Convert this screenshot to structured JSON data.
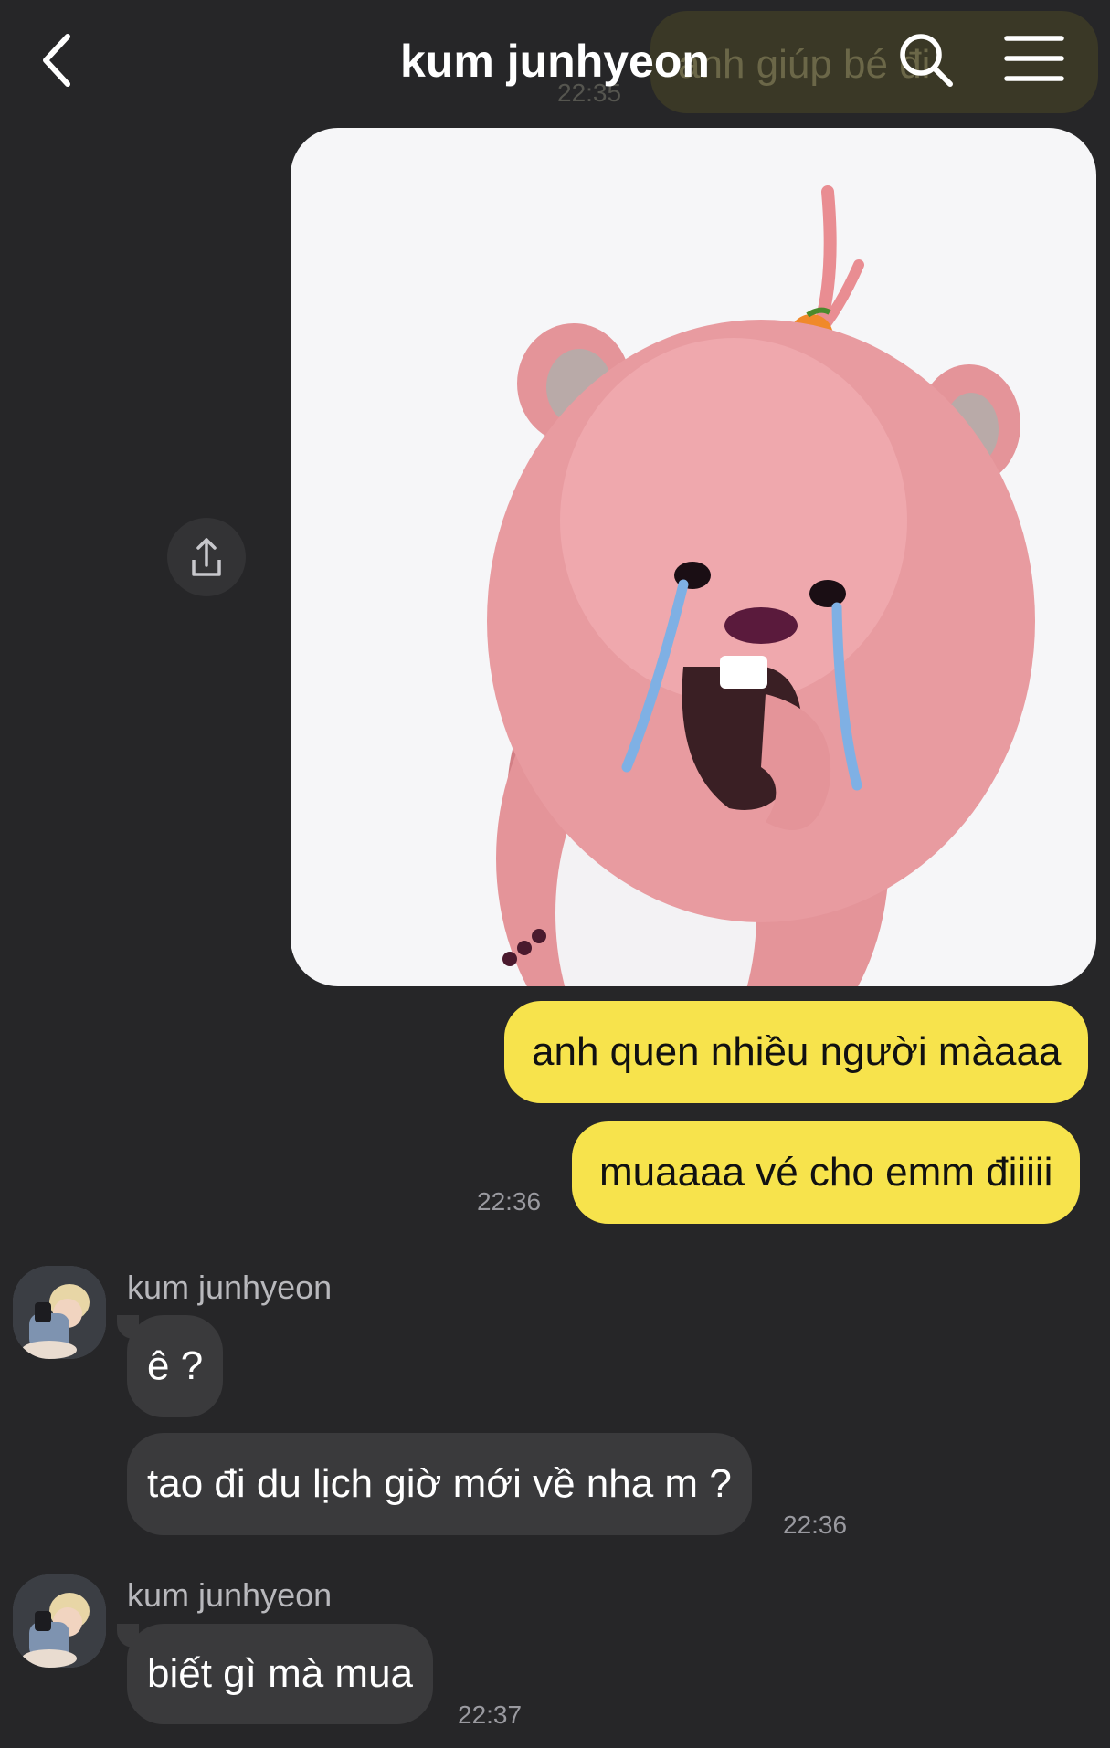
{
  "header": {
    "title": "kum junhyeon",
    "back_icon": "chevron-left-icon",
    "search_icon": "search-icon",
    "menu_icon": "menu-icon"
  },
  "ghost_message": {
    "text": "anh giúp bé đi",
    "time": "22:35"
  },
  "sticker": {
    "description_icon": "pink-beaver-crying-sticker",
    "share_icon": "share-icon"
  },
  "outgoing": [
    {
      "text": "anh quen nhiều người màaaa"
    },
    {
      "text": "muaaaa vé cho emm điiiii",
      "time": "22:36"
    }
  ],
  "incoming_groups": [
    {
      "sender": "kum junhyeon",
      "messages": [
        {
          "text": "ê ?"
        },
        {
          "text": "tao đi du lịch giờ mới về nha m ?",
          "time": "22:36"
        }
      ]
    },
    {
      "sender": "kum junhyeon",
      "messages": [
        {
          "text": "biết gì mà mua",
          "time": "22:37"
        }
      ]
    }
  ],
  "colors": {
    "background": "#262628",
    "outgoing_bubble": "#f7e34c",
    "incoming_bubble": "#3a3a3c",
    "sticker_bg": "#f6f6f8"
  }
}
